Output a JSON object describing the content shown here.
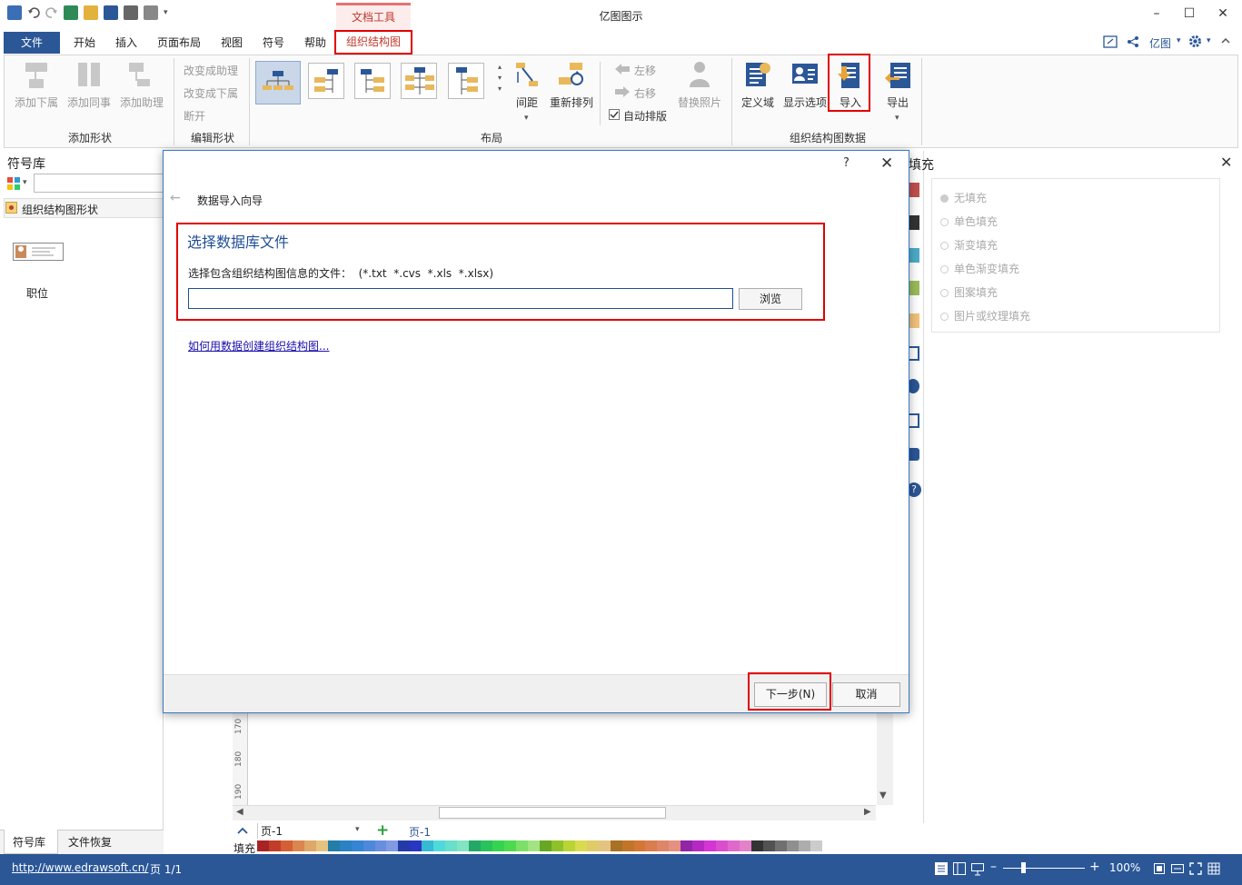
{
  "app": {
    "title": "亿图图示",
    "context_tab": "文档工具"
  },
  "menu": {
    "file": "文件",
    "tabs": [
      "开始",
      "插入",
      "页面布局",
      "视图",
      "符号",
      "帮助"
    ],
    "active_tab": "组织结构图",
    "account": "亿图"
  },
  "ribbon": {
    "add_shapes": {
      "label": "添加形状",
      "buttons": [
        "添加下属",
        "添加同事",
        "添加助理"
      ]
    },
    "edit_shapes": {
      "label": "编辑形状",
      "buttons": [
        "改变成助理",
        "改变成下属",
        "断开"
      ]
    },
    "layout": {
      "label": "布局",
      "spacing": "间距",
      "rearrange": "重新排列",
      "move_left": "左移",
      "move_right": "右移",
      "auto_layout": "自动排版",
      "replace_photo": "替换照片"
    },
    "org_data": {
      "label": "组织结构图数据",
      "define_field": "定义域",
      "display_options": "显示选项",
      "import": "导入",
      "export": "导出"
    }
  },
  "left_panel": {
    "title": "符号库",
    "category": "组织结构图形状",
    "shape_label": "职位",
    "tabs": [
      "符号库",
      "文件恢复"
    ]
  },
  "right_panel": {
    "title": "填充",
    "options": [
      "无填充",
      "单色填充",
      "渐变填充",
      "单色渐变填充",
      "图案填充",
      "图片或纹理填充"
    ]
  },
  "dialog": {
    "help": "?",
    "close": "✕",
    "breadcrumb": "数据导入向导",
    "heading": "选择数据库文件",
    "instruction": "选择包含组织结构图信息的文件：  (*.txt  *.cvs  *.xls  *.xlsx)",
    "file_value": "",
    "browse": "浏览",
    "help_link": "如何用数据创建组织结构图...",
    "next": "下一步(N)",
    "cancel": "取消"
  },
  "canvas": {
    "ruler": [
      "170",
      "180",
      "190"
    ]
  },
  "page_bar": {
    "page_select": "页-1",
    "page_tab": "页-1",
    "fill_label": "填充"
  },
  "status": {
    "url": "http://www.edrawsoft.cn/",
    "page": "页 1/1",
    "zoom": "100%"
  },
  "colors": {
    "accent": "#2b5797",
    "highlight": "#e00000",
    "link": "#1a0dab"
  }
}
